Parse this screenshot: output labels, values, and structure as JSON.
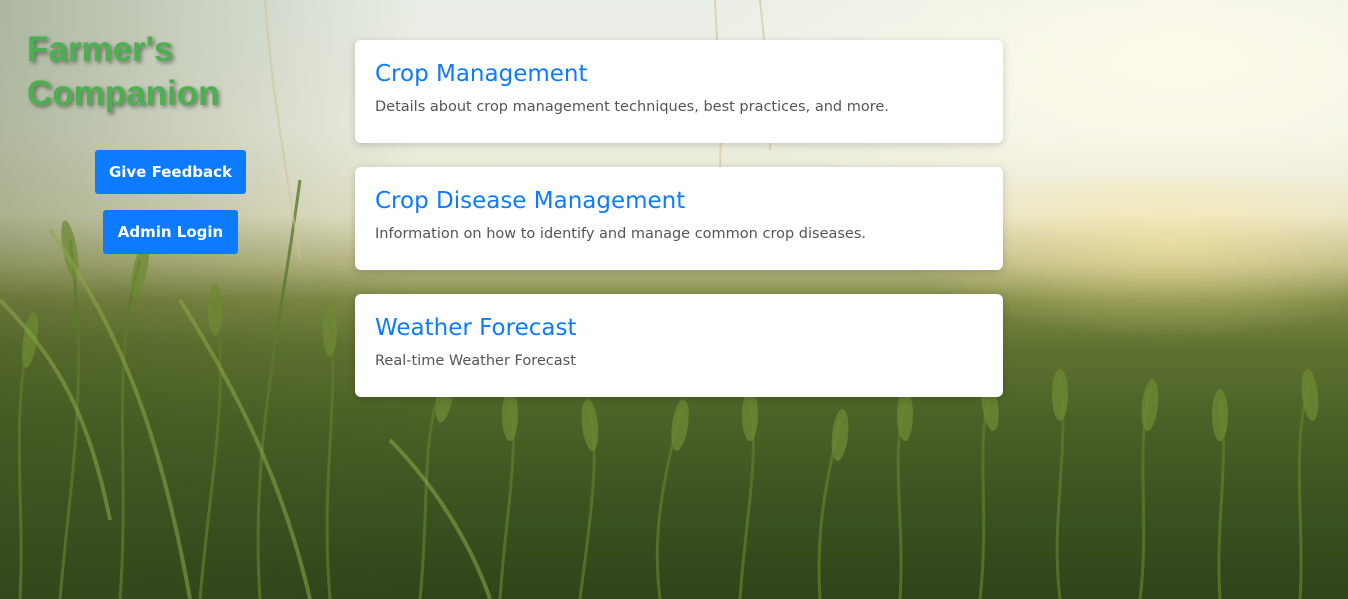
{
  "brand": {
    "line1": "Farmer's",
    "line2": "Companion"
  },
  "buttons": {
    "feedback_label": "Give Feedback",
    "admin_label": "Admin Login"
  },
  "cards": [
    {
      "title": "Crop Management",
      "description": "Details about crop management techniques, best practices, and more."
    },
    {
      "title": "Crop Disease Management",
      "description": "Information on how to identify and manage common crop diseases."
    },
    {
      "title": "Weather Forecast",
      "description": "Real-time Weather Forecast"
    }
  ],
  "colors": {
    "accent": "#0d7bff",
    "brand_green": "#4caf50",
    "card_text": "#555555"
  }
}
